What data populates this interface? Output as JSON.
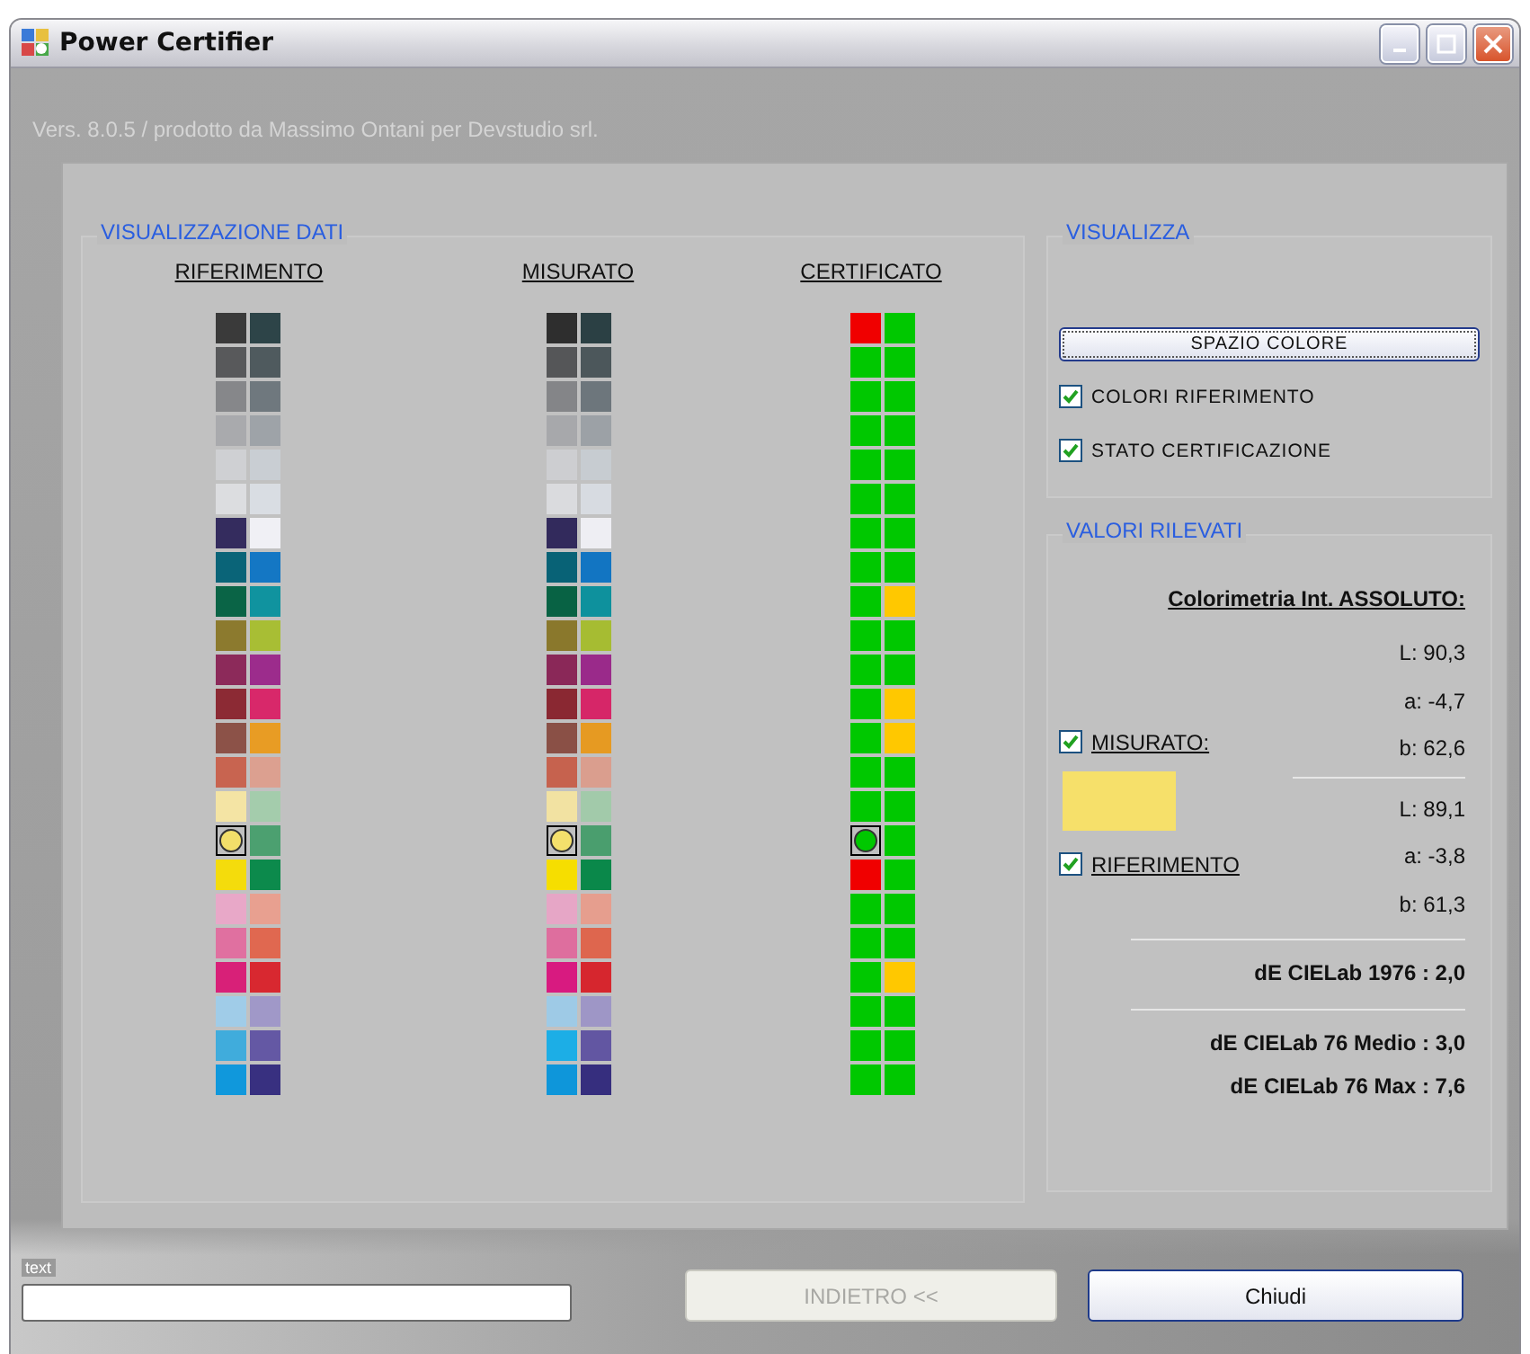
{
  "window": {
    "title": "Power Certifier"
  },
  "version": "Vers. 8.0.5 / prodotto da Massimo Ontani per Devstudio srl.",
  "data_view": {
    "title": "VISUALIZZAZIONE DATI",
    "columns": [
      {
        "heading": "RIFERIMENTO",
        "rows": [
          [
            {
              "color": "#3a3a3a",
              "selected": false
            },
            {
              "color": "#2d4448",
              "selected": false
            }
          ],
          [
            {
              "color": "#58595b",
              "selected": false
            },
            {
              "color": "#4f5a5e",
              "selected": false
            }
          ],
          [
            {
              "color": "#86878a",
              "selected": false
            },
            {
              "color": "#6f787e",
              "selected": false
            }
          ],
          [
            {
              "color": "#a9aaad",
              "selected": false
            },
            {
              "color": "#9ea3a8",
              "selected": false
            }
          ],
          [
            {
              "color": "#cfd0d3",
              "selected": false
            },
            {
              "color": "#c9ced3",
              "selected": false
            }
          ],
          [
            {
              "color": "#dcdde0",
              "selected": false
            },
            {
              "color": "#d9dde3",
              "selected": false
            }
          ],
          [
            {
              "color": "#342c5e",
              "selected": false
            },
            {
              "color": "#f0f0f5",
              "selected": false
            }
          ],
          [
            {
              "color": "#0a6478",
              "selected": false
            },
            {
              "color": "#1477c4",
              "selected": false
            }
          ],
          [
            {
              "color": "#0a6446",
              "selected": false
            },
            {
              "color": "#10939f",
              "selected": false
            }
          ],
          [
            {
              "color": "#8c7a2e",
              "selected": false
            },
            {
              "color": "#a8be34",
              "selected": false
            }
          ],
          [
            {
              "color": "#8c2a5a",
              "selected": false
            },
            {
              "color": "#9c2c8c",
              "selected": false
            }
          ],
          [
            {
              "color": "#8c2a34",
              "selected": false
            },
            {
              "color": "#d8286a",
              "selected": false
            }
          ],
          [
            {
              "color": "#8c5248",
              "selected": false
            },
            {
              "color": "#e89c24",
              "selected": false
            }
          ],
          [
            {
              "color": "#c86450",
              "selected": false
            },
            {
              "color": "#dca090",
              "selected": false
            }
          ],
          [
            {
              "color": "#f4e4a4",
              "selected": false
            },
            {
              "color": "#a4ccac",
              "selected": false
            }
          ],
          [
            {
              "color": "#f2de6a",
              "selected": true
            },
            {
              "color": "#4ca070",
              "selected": false
            }
          ],
          [
            {
              "color": "#f4dc0c",
              "selected": false
            },
            {
              "color": "#0c8a4c",
              "selected": false
            }
          ],
          [
            {
              "color": "#e8a8c8",
              "selected": false
            },
            {
              "color": "#e8a090",
              "selected": false
            }
          ],
          [
            {
              "color": "#e070a0",
              "selected": false
            },
            {
              "color": "#e06850",
              "selected": false
            }
          ],
          [
            {
              "color": "#d82078",
              "selected": false
            },
            {
              "color": "#d82830",
              "selected": false
            }
          ],
          [
            {
              "color": "#a0cce8",
              "selected": false
            },
            {
              "color": "#a098c8",
              "selected": false
            }
          ],
          [
            {
              "color": "#40acdc",
              "selected": false
            },
            {
              "color": "#6458a4",
              "selected": false
            }
          ],
          [
            {
              "color": "#1098dc",
              "selected": false
            },
            {
              "color": "#383080",
              "selected": false
            }
          ]
        ]
      },
      {
        "heading": "MISURATO",
        "rows": [
          [
            {
              "color": "#2e2e2e",
              "selected": false
            },
            {
              "color": "#2b4044",
              "selected": false
            }
          ],
          [
            {
              "color": "#555658",
              "selected": false
            },
            {
              "color": "#4c575b",
              "selected": false
            }
          ],
          [
            {
              "color": "#848588",
              "selected": false
            },
            {
              "color": "#6d767c",
              "selected": false
            }
          ],
          [
            {
              "color": "#a7a8ab",
              "selected": false
            },
            {
              "color": "#9ca1a6",
              "selected": false
            }
          ],
          [
            {
              "color": "#cdced1",
              "selected": false
            },
            {
              "color": "#c7ccd1",
              "selected": false
            }
          ],
          [
            {
              "color": "#dadbde",
              "selected": false
            },
            {
              "color": "#d7dbe1",
              "selected": false
            }
          ],
          [
            {
              "color": "#322a5c",
              "selected": false
            },
            {
              "color": "#eeeef3",
              "selected": false
            }
          ],
          [
            {
              "color": "#086276",
              "selected": false
            },
            {
              "color": "#1275c2",
              "selected": false
            }
          ],
          [
            {
              "color": "#086244",
              "selected": false
            },
            {
              "color": "#0e919d",
              "selected": false
            }
          ],
          [
            {
              "color": "#8a782c",
              "selected": false
            },
            {
              "color": "#a6bc32",
              "selected": false
            }
          ],
          [
            {
              "color": "#8a2858",
              "selected": false
            },
            {
              "color": "#9a2a8a",
              "selected": false
            }
          ],
          [
            {
              "color": "#8a2832",
              "selected": false
            },
            {
              "color": "#d62668",
              "selected": false
            }
          ],
          [
            {
              "color": "#8a5046",
              "selected": false
            },
            {
              "color": "#e69a22",
              "selected": false
            }
          ],
          [
            {
              "color": "#c6624e",
              "selected": false
            },
            {
              "color": "#da9e8e",
              "selected": false
            }
          ],
          [
            {
              "color": "#f2e2a2",
              "selected": false
            },
            {
              "color": "#a2caaa",
              "selected": false
            }
          ],
          [
            {
              "color": "#f4e06c",
              "selected": true
            },
            {
              "color": "#4a9e6e",
              "selected": false
            }
          ],
          [
            {
              "color": "#f6de00",
              "selected": false
            },
            {
              "color": "#0a884a",
              "selected": false
            }
          ],
          [
            {
              "color": "#e6a6c6",
              "selected": false
            },
            {
              "color": "#e69e8e",
              "selected": false
            }
          ],
          [
            {
              "color": "#de6e9e",
              "selected": false
            },
            {
              "color": "#de664e",
              "selected": false
            }
          ],
          [
            {
              "color": "#d81a80",
              "selected": false
            },
            {
              "color": "#d6262e",
              "selected": false
            }
          ],
          [
            {
              "color": "#9ecae6",
              "selected": false
            },
            {
              "color": "#9e96c6",
              "selected": false
            }
          ],
          [
            {
              "color": "#1caee6",
              "selected": false
            },
            {
              "color": "#6256a2",
              "selected": false
            }
          ],
          [
            {
              "color": "#0e96da",
              "selected": false
            },
            {
              "color": "#362e7e",
              "selected": false
            }
          ]
        ]
      },
      {
        "heading": "CERTIFICATO",
        "rows": [
          [
            {
              "color": "#f00000",
              "selected": false
            },
            {
              "color": "#00c800",
              "selected": false
            }
          ],
          [
            {
              "color": "#00c800",
              "selected": false
            },
            {
              "color": "#00c800",
              "selected": false
            }
          ],
          [
            {
              "color": "#00c800",
              "selected": false
            },
            {
              "color": "#00c800",
              "selected": false
            }
          ],
          [
            {
              "color": "#00c800",
              "selected": false
            },
            {
              "color": "#00c800",
              "selected": false
            }
          ],
          [
            {
              "color": "#00c800",
              "selected": false
            },
            {
              "color": "#00c800",
              "selected": false
            }
          ],
          [
            {
              "color": "#00c800",
              "selected": false
            },
            {
              "color": "#00c800",
              "selected": false
            }
          ],
          [
            {
              "color": "#00c800",
              "selected": false
            },
            {
              "color": "#00c800",
              "selected": false
            }
          ],
          [
            {
              "color": "#00c800",
              "selected": false
            },
            {
              "color": "#00c800",
              "selected": false
            }
          ],
          [
            {
              "color": "#00c800",
              "selected": false
            },
            {
              "color": "#ffc800",
              "selected": false
            }
          ],
          [
            {
              "color": "#00c800",
              "selected": false
            },
            {
              "color": "#00c800",
              "selected": false
            }
          ],
          [
            {
              "color": "#00c800",
              "selected": false
            },
            {
              "color": "#00c800",
              "selected": false
            }
          ],
          [
            {
              "color": "#00c800",
              "selected": false
            },
            {
              "color": "#ffc800",
              "selected": false
            }
          ],
          [
            {
              "color": "#00c800",
              "selected": false
            },
            {
              "color": "#ffc800",
              "selected": false
            }
          ],
          [
            {
              "color": "#00c800",
              "selected": false
            },
            {
              "color": "#00c800",
              "selected": false
            }
          ],
          [
            {
              "color": "#00c800",
              "selected": false
            },
            {
              "color": "#00c800",
              "selected": false
            }
          ],
          [
            {
              "color": "#00c800",
              "selected": true
            },
            {
              "color": "#00c800",
              "selected": false
            }
          ],
          [
            {
              "color": "#f00000",
              "selected": false
            },
            {
              "color": "#00c800",
              "selected": false
            }
          ],
          [
            {
              "color": "#00c800",
              "selected": false
            },
            {
              "color": "#00c800",
              "selected": false
            }
          ],
          [
            {
              "color": "#00c800",
              "selected": false
            },
            {
              "color": "#00c800",
              "selected": false
            }
          ],
          [
            {
              "color": "#00c800",
              "selected": false
            },
            {
              "color": "#ffc800",
              "selected": false
            }
          ],
          [
            {
              "color": "#00c800",
              "selected": false
            },
            {
              "color": "#00c800",
              "selected": false
            }
          ],
          [
            {
              "color": "#00c800",
              "selected": false
            },
            {
              "color": "#00c800",
              "selected": false
            }
          ],
          [
            {
              "color": "#00c800",
              "selected": false
            },
            {
              "color": "#00c800",
              "selected": false
            }
          ]
        ]
      }
    ]
  },
  "display": {
    "title": "VISUALIZZA",
    "button": "SPAZIO COLORE",
    "options": [
      {
        "label": "COLORI RIFERIMENTO",
        "checked": true
      },
      {
        "label": "STATO CERTIFICAZIONE",
        "checked": true
      }
    ]
  },
  "values": {
    "title": "VALORI RILEVATI",
    "heading": "Colorimetria Int. ASSOLUTO:",
    "measured": {
      "label": "MISURATO:",
      "checked": true,
      "values": [
        "L: 90,3",
        "a: -4,7",
        "b: 62,6"
      ]
    },
    "preview": {
      "color": "#f6e06a"
    },
    "reference": {
      "label": "RIFERIMENTO",
      "checked": true,
      "values": [
        "L: 89,1",
        "a: -3,8",
        "b: 61,3"
      ]
    },
    "delta": "dE CIELab 1976 : 2,0",
    "summary": [
      "dE CIELab 76 Medio : 3,0",
      "dE CIELab 76 Max : 7,6"
    ]
  },
  "footer": {
    "field_label": "text",
    "buttons": [
      {
        "label": "INDIETRO <<",
        "disabled": true
      },
      {
        "label": "Chiudi",
        "disabled": false
      }
    ]
  }
}
